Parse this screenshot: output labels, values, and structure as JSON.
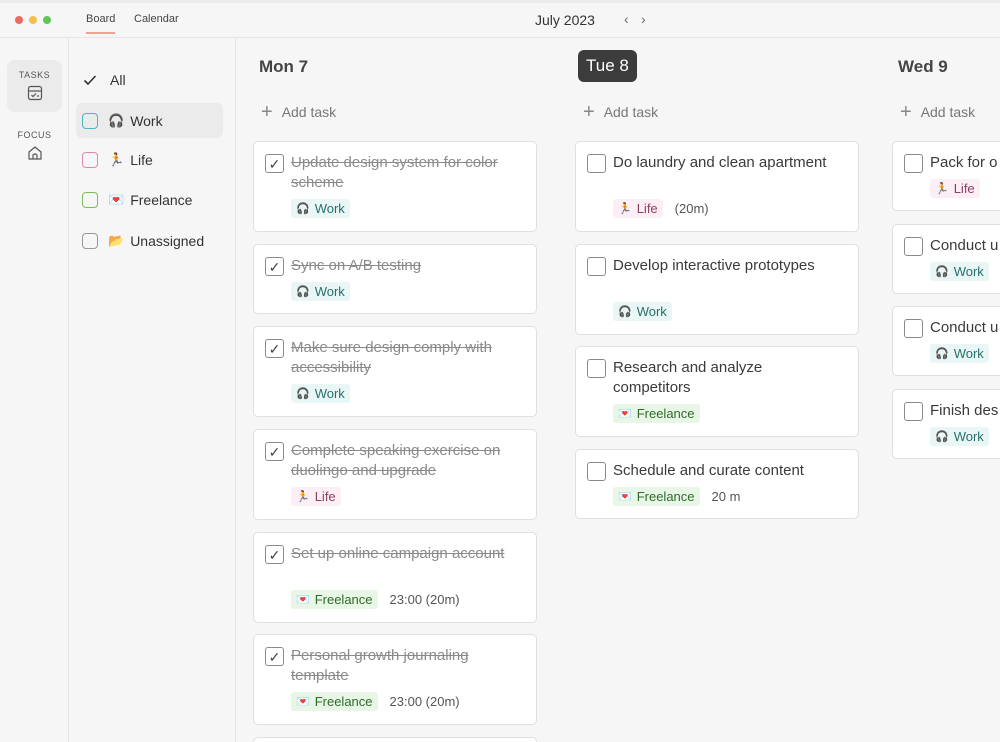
{
  "window": {
    "controls": {
      "close": "#ec6a5e",
      "minimize": "#f4bf4f",
      "maximize": "#61c554"
    },
    "tabs": [
      {
        "label": "Board",
        "active": true
      },
      {
        "label": "Calendar",
        "active": false
      }
    ],
    "month": "July 2023",
    "prev": "‹",
    "next": "›"
  },
  "rail": {
    "tasks": {
      "label": "TASKS",
      "icon": "checklist-icon"
    },
    "focus": {
      "label": "FOCUS",
      "icon": "home-icon"
    }
  },
  "categories": [
    {
      "label": "All",
      "icon": "check",
      "color": ""
    },
    {
      "label": "Work",
      "icon": "🎧",
      "color": "#4fb3c3"
    },
    {
      "label": "Life",
      "icon": "🏃",
      "color": "#e08ab0"
    },
    {
      "label": "Freelance",
      "icon": "💌",
      "color": "#7cbb5a"
    },
    {
      "label": "Unassigned",
      "icon": "📂",
      "color": "#999999"
    }
  ],
  "days": [
    {
      "title": "Mon 7",
      "today": false,
      "add_label": "Add task",
      "tasks": [
        {
          "title": "Update design system for color scheme",
          "done": true,
          "tag": "Work",
          "tag_icon": "🎧",
          "time": ""
        },
        {
          "title": "Sync on A/B testing",
          "done": true,
          "tag": "Work",
          "tag_icon": "🎧",
          "time": ""
        },
        {
          "title": "Make sure design comply with accessibility",
          "done": true,
          "tag": "Work",
          "tag_icon": "🎧",
          "time": ""
        },
        {
          "title": "Complete speaking exercise on duolingo and upgrade",
          "done": true,
          "tag": "Life",
          "tag_icon": "🏃",
          "time": ""
        },
        {
          "title": "Set up online campaign account",
          "done": true,
          "tag": "Freelance",
          "tag_icon": "💌",
          "time": "23:00 (20m)"
        },
        {
          "title": "Personal growth journaling template",
          "done": true,
          "tag": "Freelance",
          "tag_icon": "💌",
          "time": "23:00 (20m)"
        }
      ]
    },
    {
      "title": "Tue 8",
      "today": true,
      "add_label": "Add task",
      "tasks": [
        {
          "title": "Do laundry and clean apartment",
          "done": false,
          "tag": "Life",
          "tag_icon": "🏃",
          "time": "(20m)"
        },
        {
          "title": "Develop interactive prototypes",
          "done": false,
          "tag": "Work",
          "tag_icon": "🎧",
          "time": ""
        },
        {
          "title": "Research and analyze competitors",
          "done": false,
          "tag": "Freelance",
          "tag_icon": "💌",
          "time": ""
        },
        {
          "title": "Schedule and curate content",
          "done": false,
          "tag": "Freelance",
          "tag_icon": "💌",
          "time": "20 m"
        }
      ]
    },
    {
      "title": "Wed 9",
      "today": false,
      "add_label": "Add task",
      "tasks": [
        {
          "title": "Pack for o",
          "done": false,
          "tag": "Life",
          "tag_icon": "🏃",
          "time": ""
        },
        {
          "title": "Conduct u",
          "done": false,
          "tag": "Work",
          "tag_icon": "🎧",
          "time": ""
        },
        {
          "title": "Conduct u",
          "done": false,
          "tag": "Work",
          "tag_icon": "🎧",
          "time": ""
        },
        {
          "title": "Finish des",
          "done": false,
          "tag": "Work",
          "tag_icon": "🎧",
          "time": ""
        }
      ]
    }
  ]
}
